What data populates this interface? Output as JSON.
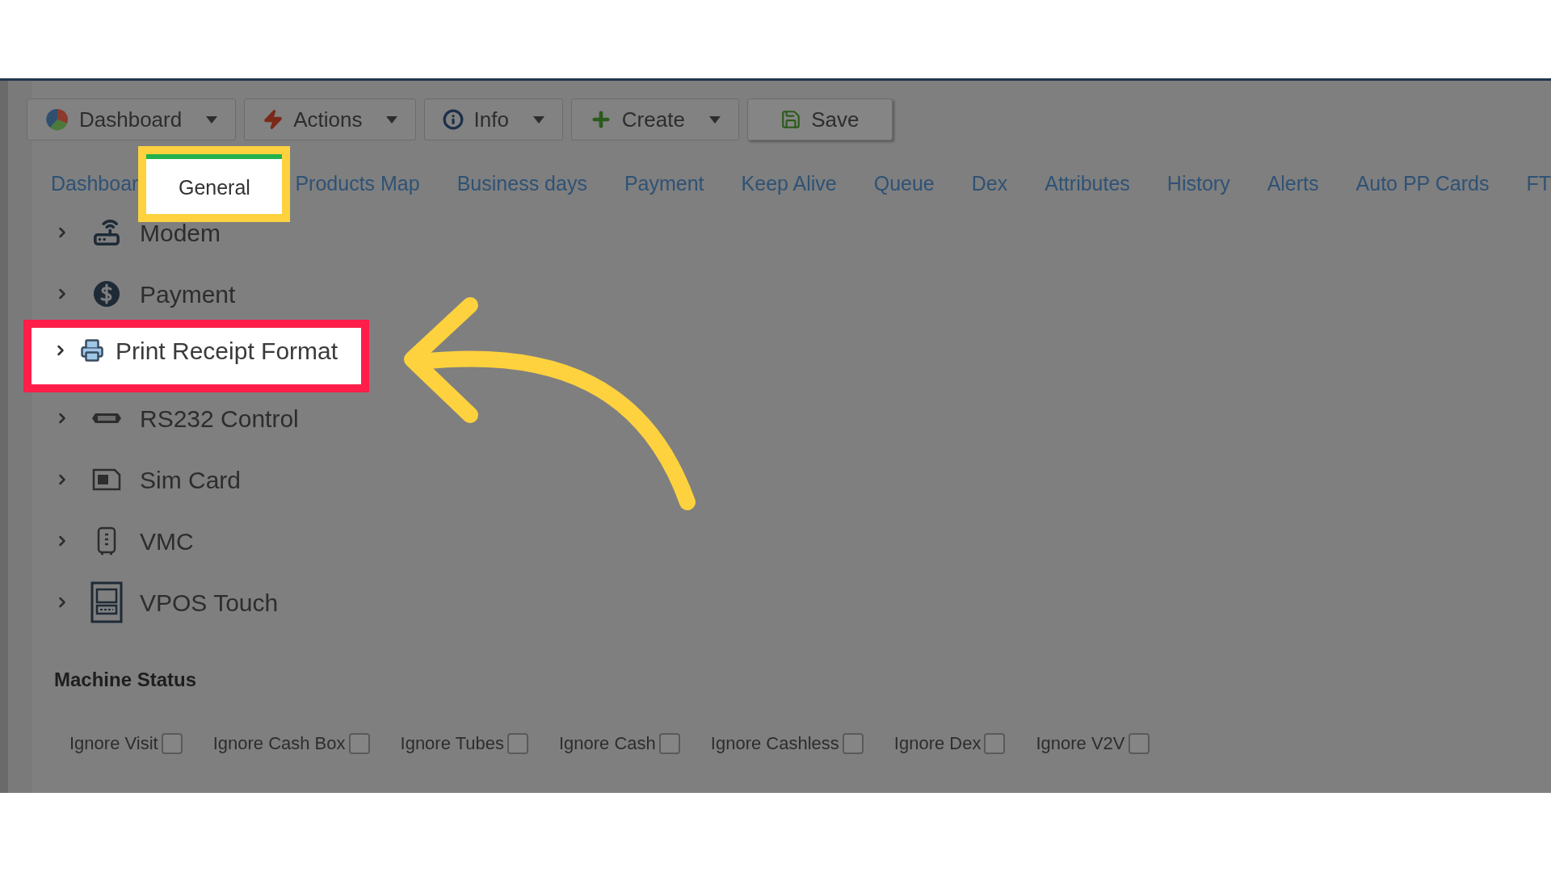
{
  "toolbar": [
    {
      "label": "Dashboard",
      "kind": "dropdown"
    },
    {
      "label": "Actions",
      "kind": "dropdown"
    },
    {
      "label": "Info",
      "kind": "dropdown"
    },
    {
      "label": "Create",
      "kind": "dropdown"
    },
    {
      "label": "Save",
      "kind": "plain"
    }
  ],
  "tabs": [
    {
      "label": "Dashboar",
      "selected": false
    },
    {
      "label": "General",
      "selected": true
    },
    {
      "label": "Products Map",
      "selected": false
    },
    {
      "label": "Business days",
      "selected": false
    },
    {
      "label": "Payment",
      "selected": false
    },
    {
      "label": "Keep Alive",
      "selected": false
    },
    {
      "label": "Queue",
      "selected": false
    },
    {
      "label": "Dex",
      "selected": false
    },
    {
      "label": "Attributes",
      "selected": false
    },
    {
      "label": "History",
      "selected": false
    },
    {
      "label": "Alerts",
      "selected": false
    },
    {
      "label": "Auto PP Cards",
      "selected": false
    },
    {
      "label": "FT",
      "selected": false
    }
  ],
  "tree": [
    {
      "label": "Modem",
      "highlighted": false,
      "expanded": false
    },
    {
      "label": "Payment",
      "highlighted": false,
      "expanded": false
    },
    {
      "label": "Print Receipt Format",
      "highlighted": true,
      "expanded": false
    },
    {
      "label": "RS232 Control",
      "highlighted": false,
      "expanded": false
    },
    {
      "label": "Sim Card",
      "highlighted": false,
      "expanded": false
    },
    {
      "label": "VMC",
      "highlighted": false,
      "expanded": false
    },
    {
      "label": "VPOS Touch",
      "highlighted": false,
      "expanded": false
    }
  ],
  "machine_status": {
    "title": "Machine Status",
    "options": [
      {
        "label": "Ignore Visit",
        "checked": false
      },
      {
        "label": "Ignore Cash Box",
        "checked": false
      },
      {
        "label": "Ignore Tubes",
        "checked": false
      },
      {
        "label": "Ignore Cash",
        "checked": false
      },
      {
        "label": "Ignore Cashless",
        "checked": false
      },
      {
        "label": "Ignore Dex",
        "checked": false
      },
      {
        "label": "Ignore V2V",
        "checked": false
      }
    ]
  }
}
